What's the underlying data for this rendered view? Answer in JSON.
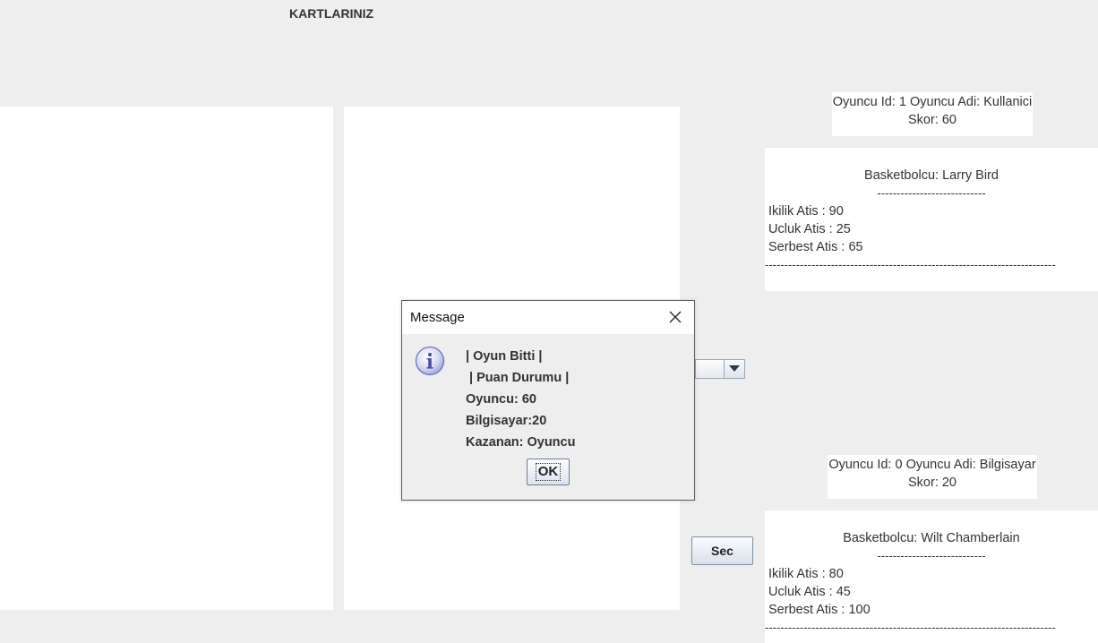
{
  "section_title": "KARTLARINIZ",
  "player_top": {
    "line1": "Oyuncu Id: 1 Oyuncu Adi: Kullanici",
    "line2": "Skor: 60"
  },
  "card_top": {
    "name": "Basketbolcu: Larry Bird",
    "short_dash": "----------------------------",
    "stat1": "Ikilik Atis : 90",
    "stat2": "Ucluk Atis : 25",
    "stat3": "Serbest Atis : 65",
    "long_dash": "---------------------------------------------------------------------------"
  },
  "player_bottom": {
    "line1": "Oyuncu Id: 0 Oyuncu Adi: Bilgisayar",
    "line2": "Skor: 20"
  },
  "card_bottom": {
    "name": "Basketbolcu: Wilt Chamberlain",
    "short_dash": "----------------------------",
    "stat1": "Ikilik Atis : 80",
    "stat2": "Ucluk Atis : 45",
    "stat3": "Serbest Atis : 100",
    "long_dash": "---------------------------------------------------------------------------"
  },
  "select_button": "Sec",
  "dialog": {
    "title": "Message",
    "lines": [
      "| Oyun Bitti |",
      " | Puan Durumu |",
      "Oyuncu: 60",
      "Bilgisayar:20",
      "Kazanan: Oyuncu"
    ],
    "ok_label": "OK",
    "icon": "info-icon"
  },
  "icons": {
    "close": "close-icon",
    "dropdown": "chevron-down-icon"
  }
}
